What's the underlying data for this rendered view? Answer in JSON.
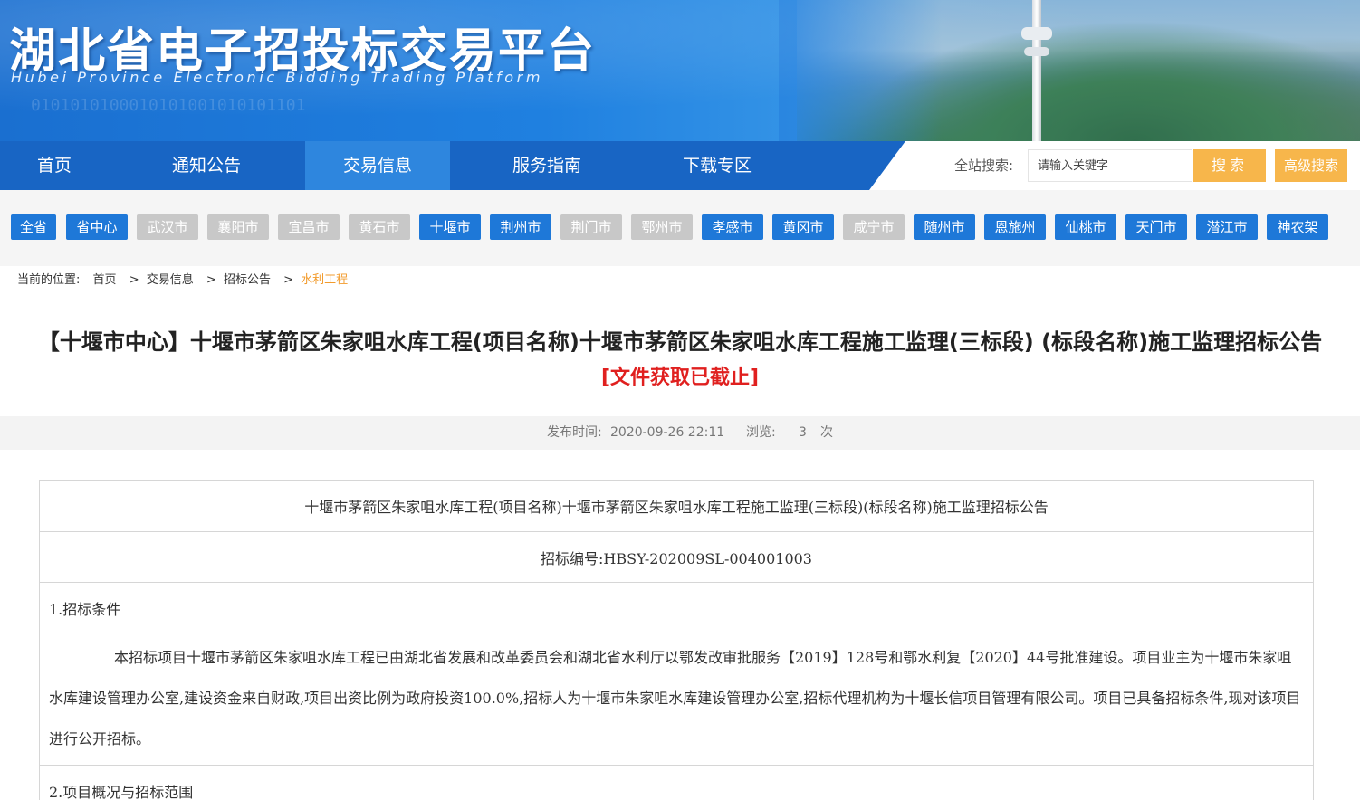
{
  "header": {
    "title": "湖北省电子招投标交易平台",
    "subtitle": "Hubei Province Electronic Bidding Trading Platform",
    "binary_decor": "0101010100010101001010101101"
  },
  "nav": {
    "items": [
      {
        "label": "首页"
      },
      {
        "label": "通知公告"
      },
      {
        "label": "交易信息"
      },
      {
        "label": "服务指南"
      },
      {
        "label": "下载专区"
      }
    ],
    "active_index": 2,
    "search_label": "全站搜索:",
    "search_placeholder": "请输入关键字",
    "search_button": "搜索",
    "advanced_button": "高级搜索"
  },
  "cities": [
    {
      "label": "全省",
      "enabled": true
    },
    {
      "label": "省中心",
      "enabled": true
    },
    {
      "label": "武汉市",
      "enabled": false
    },
    {
      "label": "襄阳市",
      "enabled": false
    },
    {
      "label": "宜昌市",
      "enabled": false
    },
    {
      "label": "黄石市",
      "enabled": false
    },
    {
      "label": "十堰市",
      "enabled": true
    },
    {
      "label": "荆州市",
      "enabled": true
    },
    {
      "label": "荆门市",
      "enabled": false
    },
    {
      "label": "鄂州市",
      "enabled": false
    },
    {
      "label": "孝感市",
      "enabled": true
    },
    {
      "label": "黄冈市",
      "enabled": true
    },
    {
      "label": "咸宁市",
      "enabled": false
    },
    {
      "label": "随州市",
      "enabled": true
    },
    {
      "label": "恩施州",
      "enabled": true
    },
    {
      "label": "仙桃市",
      "enabled": true
    },
    {
      "label": "天门市",
      "enabled": true
    },
    {
      "label": "潜江市",
      "enabled": true
    },
    {
      "label": "神农架",
      "enabled": true
    }
  ],
  "breadcrumb": {
    "prefix": "当前的位置:",
    "items": [
      "首页",
      "交易信息",
      "招标公告",
      "水利工程"
    ],
    "separator": ">"
  },
  "article": {
    "title": "【十堰市中心】十堰市茅箭区朱家咀水库工程(项目名称)十堰市茅箭区朱家咀水库工程施工监理(三标段) (标段名称)施工监理招标公告",
    "status": "[文件获取已截止]",
    "publish_label": "发布时间:",
    "publish_time": "2020-09-26 22:11",
    "views_label": "浏览:",
    "views_count": "3",
    "views_unit": "次"
  },
  "document": {
    "heading": "十堰市茅箭区朱家咀水库工程(项目名称)十堰市茅箭区朱家咀水库工程施工监理(三标段)(标段名称)施工监理招标公告",
    "bid_number": "招标编号:HBSY-202009SL-004001003",
    "section1_title": "1.招标条件",
    "section1_body": "本招标项目十堰市茅箭区朱家咀水库工程已由湖北省发展和改革委员会和湖北省水利厅以鄂发改审批服务【2019】128号和鄂水利复【2020】44号批准建设。项目业主为十堰市朱家咀水库建设管理办公室,建设资金来自财政,项目出资比例为政府投资100.0%,招标人为十堰市朱家咀水库建设管理办公室,招标代理机构为十堰长信项目管理有限公司。项目已具备招标条件,现对该项目进行公开招标。",
    "section2_title": "2.项目概况与招标范围"
  },
  "colors": {
    "nav_bg": "#1865c4",
    "nav_active": "#2e86de",
    "tab_on": "#1e78d8",
    "tab_off": "#c8c8c8",
    "accent_orange": "#f7b64b",
    "deadline_red": "#e0201f",
    "breadcrumb_current": "#f29b2c"
  }
}
